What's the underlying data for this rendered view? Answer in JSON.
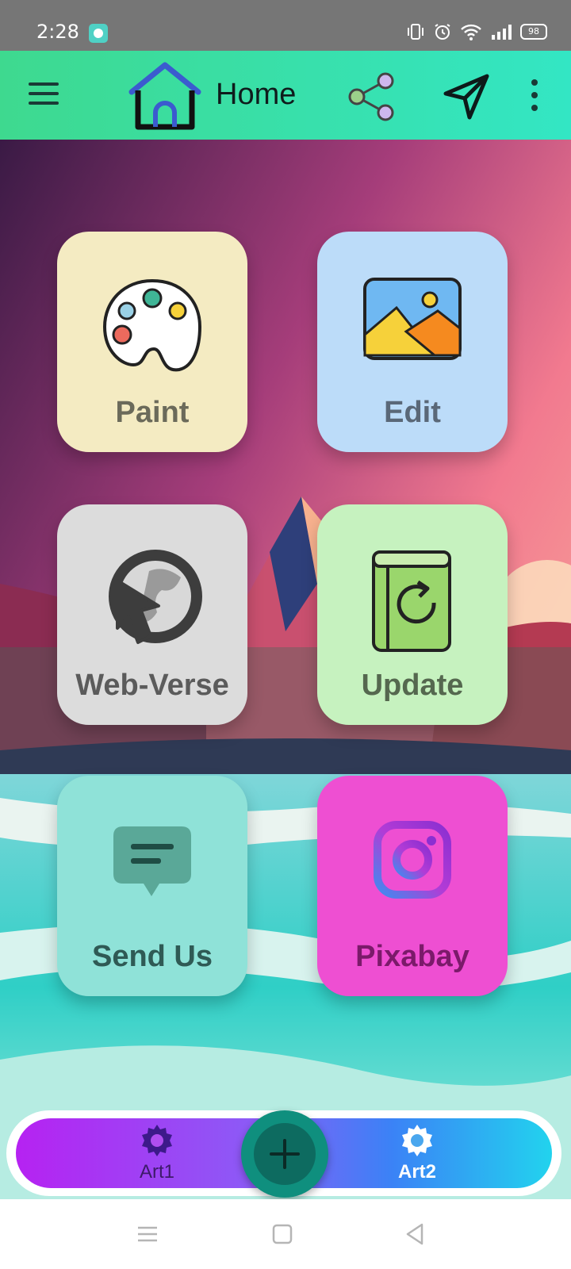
{
  "status": {
    "time": "2:28",
    "battery": "98"
  },
  "appbar": {
    "title": "Home"
  },
  "tiles": [
    {
      "label": "Paint",
      "bg": "#f4ebc2",
      "fg": "#6b6a5a",
      "icon": "palette-icon"
    },
    {
      "label": "Edit",
      "bg": "#bcdcf9",
      "fg": "#5a6878",
      "icon": "image-icon"
    },
    {
      "label": "Web-Verse",
      "bg": "#dcdcdc",
      "fg": "#5b5b5b",
      "icon": "globe-cursor-icon"
    },
    {
      "label": "Update",
      "bg": "#c6f2bf",
      "fg": "#55684f",
      "icon": "book-refresh-icon"
    },
    {
      "label": "Send Us",
      "bg": "#8fe2d8",
      "fg": "#2f5a55",
      "icon": "chat-icon"
    },
    {
      "label": "Pixabay",
      "bg": "#ee4fd2",
      "fg": "#7b1a6a",
      "icon": "instagram-icon"
    }
  ],
  "bottom_nav": {
    "items": [
      {
        "label": "Art1",
        "icon": "gear-icon",
        "active": false
      },
      {
        "label": "Art2",
        "icon": "gear-icon",
        "active": true
      }
    ],
    "fab_icon": "plus-icon"
  }
}
